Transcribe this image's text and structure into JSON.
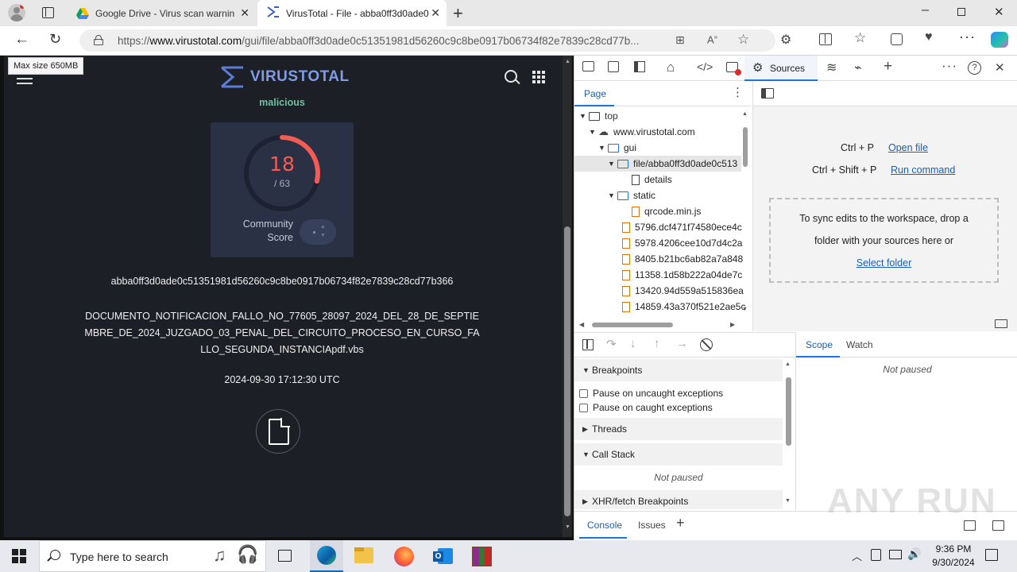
{
  "browser": {
    "tabs": [
      {
        "title": "Google Drive - Virus scan warnin",
        "active": false
      },
      {
        "title": "VirusTotal - File - abba0ff3d0ade0",
        "active": true
      }
    ],
    "url_prefix": "https://",
    "url_host": "www.virustotal.com",
    "url_path": "/gui/file/abba0ff3d0ade0c51351981d56260c9c8be0917b06734f82e7839c28cd77b..."
  },
  "tooltip": "Max size 650MB",
  "vt": {
    "logo": "VIRUSTOTAL",
    "verdict": "malicious",
    "score": "18",
    "total": "/ 63",
    "detection_fraction": 0.2857,
    "community_label_1": "Community",
    "community_label_2": "Score",
    "hash": "abba0ff3d0ade0c51351981d56260c9c8be0917b06734f82e7839c28cd77b366",
    "filename_line1": "DOCUMENTO_NOTIFICACION_FALLO_NO_77605_28097_2024_DEL_28_DE_SEPTIE",
    "filename_line2": "MBRE_DE_2024_JUZGADO_03_PENAL_DEL_CIRCUITO_PROCESO_EN_CURSO_FA",
    "filename_line3": "LLO_SEGUNDA_INSTANCIApdf.vbs",
    "date": "2024-09-30 17:12:30 UTC"
  },
  "devtools": {
    "sources_tab": "Sources",
    "page_tab": "Page",
    "tree": {
      "top": "top",
      "host": "www.virustotal.com",
      "gui": "gui",
      "file": "file/abba0ff3d0ade0c513",
      "details": "details",
      "static": "static",
      "qrcode": "qrcode.min.js",
      "f1": "5796.dcf471f74580ece4c",
      "f2": "5978.4206cee10d7d4c2a",
      "f3": "8405.b21bc6ab82a7a848",
      "f4": "11358.1d58b222a04de7c",
      "f5": "13420.94d559a515836ea",
      "f6": "14859.43a370f521e2ae5c"
    },
    "shortcut1_keys": "Ctrl + P",
    "shortcut1_action": "Open file",
    "shortcut2_keys": "Ctrl + Shift + P",
    "shortcut2_action": "Run command",
    "drop_line1": "To sync edits to the workspace, drop a",
    "drop_line2": "folder with your sources here or",
    "drop_link": "Select folder",
    "breakpoints": "Breakpoints",
    "pause_uncaught": "Pause on uncaught exceptions",
    "pause_caught": "Pause on caught exceptions",
    "threads": "Threads",
    "call_stack": "Call Stack",
    "not_paused": "Not paused",
    "xhr": "XHR/fetch Breakpoints",
    "scope_tab": "Scope",
    "watch_tab": "Watch",
    "console_tab": "Console",
    "issues_tab": "Issues"
  },
  "watermark": "ANY RUN",
  "taskbar": {
    "search_placeholder": "Type here to search",
    "time": "9:36 PM",
    "date": "9/30/2024"
  },
  "colors": {
    "vt_bg": "#1d1f26",
    "vt_accent": "#5b7cd6",
    "malicious": "#6fbf9f",
    "score_red": "#f25c54",
    "link": "#1a5fb4"
  }
}
